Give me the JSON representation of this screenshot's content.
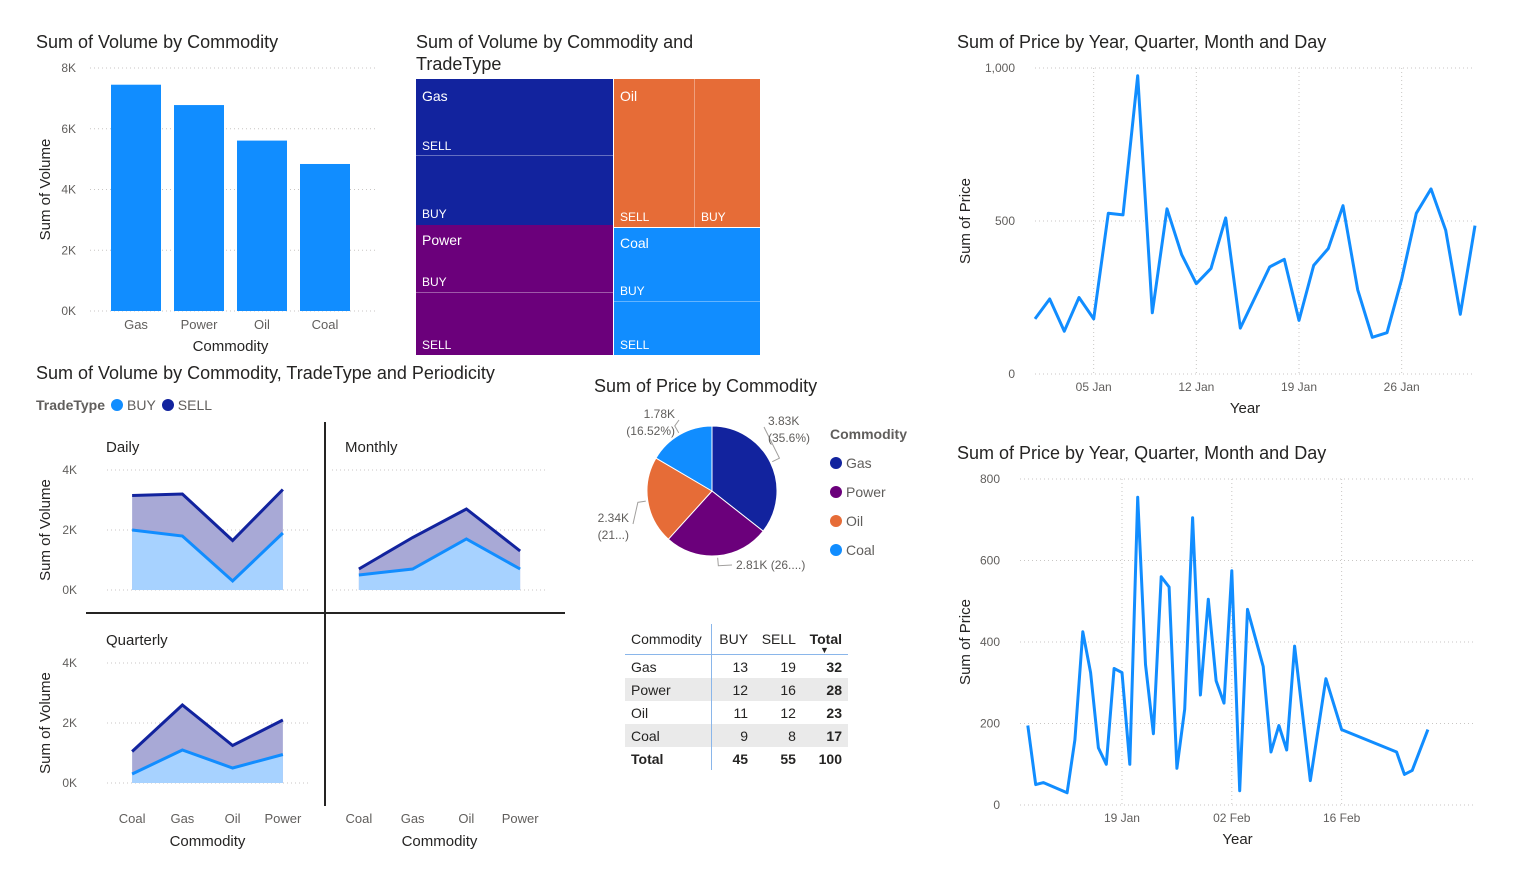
{
  "colors": {
    "bar": "#118DFF",
    "navy": "#12239E",
    "purple": "#6B007B",
    "orange": "#E66C37",
    "blue": "#118DFF",
    "buy_fill": "#A7D2FF",
    "sell_fill": "#A8A9D6",
    "axis_text": "#605e5c",
    "grid": "#c8c6c4"
  },
  "bar_chart": {
    "title": "Sum of Volume by Commodity",
    "chart_data": {
      "type": "bar",
      "categories": [
        "Gas",
        "Power",
        "Oil",
        "Coal"
      ],
      "values": [
        7450,
        6780,
        5610,
        4840
      ],
      "xlabel": "Commodity",
      "ylabel": "Sum of Volume",
      "ylim": [
        0,
        8000
      ],
      "yticks": [
        "0K",
        "2K",
        "4K",
        "6K",
        "8K"
      ],
      "grid": true
    }
  },
  "treemap": {
    "title_line1": "Sum of Volume by Commodity and",
    "title_line2": "TradeType",
    "chart_data": {
      "type": "treemap",
      "groups": [
        {
          "name": "Gas",
          "children": [
            "SELL",
            "BUY"
          ]
        },
        {
          "name": "Oil",
          "children": [
            "SELL",
            "BUY"
          ]
        },
        {
          "name": "Power",
          "children": [
            "BUY",
            "SELL"
          ]
        },
        {
          "name": "Coal",
          "children": [
            "BUY",
            "SELL"
          ]
        }
      ]
    }
  },
  "line_chart_1": {
    "title": "Sum of Price by Year, Quarter, Month and Day",
    "chart_data": {
      "type": "line",
      "xlabel": "Year",
      "ylabel": "Sum of Price",
      "x_ticks": [
        "05 Jan",
        "12 Jan",
        "19 Jan",
        "26 Jan"
      ],
      "y_ticks": [
        "0",
        "500",
        "1,000"
      ],
      "ylim": [
        0,
        1000
      ],
      "x_range": [
        "2024-01-01",
        "2024-01-31"
      ],
      "points": [
        [
          "2024-01-01",
          180
        ],
        [
          "2024-01-02",
          245
        ],
        [
          "2024-01-03",
          140
        ],
        [
          "2024-01-04",
          250
        ],
        [
          "2024-01-05",
          180
        ],
        [
          "2024-01-06",
          525
        ],
        [
          "2024-01-07",
          520
        ],
        [
          "2024-01-08",
          975
        ],
        [
          "2024-01-09",
          200
        ],
        [
          "2024-01-10",
          540
        ],
        [
          "2024-01-11",
          390
        ],
        [
          "2024-01-12",
          295
        ],
        [
          "2024-01-13",
          345
        ],
        [
          "2024-01-14",
          510
        ],
        [
          "2024-01-15",
          150
        ],
        [
          "2024-01-17",
          350
        ],
        [
          "2024-01-18",
          375
        ],
        [
          "2024-01-19",
          175
        ],
        [
          "2024-01-20",
          355
        ],
        [
          "2024-01-21",
          410
        ],
        [
          "2024-01-22",
          550
        ],
        [
          "2024-01-23",
          275
        ],
        [
          "2024-01-24",
          120
        ],
        [
          "2024-01-25",
          135
        ],
        [
          "2024-01-26",
          310
        ],
        [
          "2024-01-27",
          525
        ],
        [
          "2024-01-28",
          605
        ],
        [
          "2024-01-29",
          470
        ],
        [
          "2024-01-30",
          195
        ],
        [
          "2024-01-31",
          485
        ]
      ]
    }
  },
  "line_chart_2": {
    "title": "Sum of Price by Year, Quarter, Month and Day",
    "chart_data": {
      "type": "line",
      "xlabel": "Year",
      "ylabel": "Sum of Price",
      "x_ticks": [
        "19 Jan",
        "02 Feb",
        "16 Feb"
      ],
      "y_ticks": [
        "0",
        "200",
        "400",
        "600",
        "800"
      ],
      "ylim": [
        0,
        800
      ],
      "x_range": [
        "2024-01-06",
        "2024-03-04"
      ],
      "points": [
        [
          "2024-01-07",
          195
        ],
        [
          "2024-01-08",
          50
        ],
        [
          "2024-01-09",
          55
        ],
        [
          "2024-01-12",
          30
        ],
        [
          "2024-01-13",
          160
        ],
        [
          "2024-01-14",
          425
        ],
        [
          "2024-01-15",
          325
        ],
        [
          "2024-01-16",
          140
        ],
        [
          "2024-01-17",
          100
        ],
        [
          "2024-01-18",
          335
        ],
        [
          "2024-01-19",
          325
        ],
        [
          "2024-01-20",
          100
        ],
        [
          "2024-01-21",
          755
        ],
        [
          "2024-01-22",
          345
        ],
        [
          "2024-01-23",
          175
        ],
        [
          "2024-01-24",
          560
        ],
        [
          "2024-01-25",
          535
        ],
        [
          "2024-01-26",
          90
        ],
        [
          "2024-01-27",
          235
        ],
        [
          "2024-01-28",
          705
        ],
        [
          "2024-01-29",
          270
        ],
        [
          "2024-01-30",
          505
        ],
        [
          "2024-01-31",
          305
        ],
        [
          "2024-02-01",
          250
        ],
        [
          "2024-02-02",
          575
        ],
        [
          "2024-02-03",
          35
        ],
        [
          "2024-02-04",
          480
        ],
        [
          "2024-02-06",
          340
        ],
        [
          "2024-02-07",
          130
        ],
        [
          "2024-02-08",
          195
        ],
        [
          "2024-02-09",
          135
        ],
        [
          "2024-02-10",
          390
        ],
        [
          "2024-02-12",
          60
        ],
        [
          "2024-02-14",
          310
        ],
        [
          "2024-02-16",
          185
        ],
        [
          "2024-02-23",
          130
        ],
        [
          "2024-02-24",
          75
        ],
        [
          "2024-02-25",
          85
        ],
        [
          "2024-02-27",
          185
        ]
      ]
    }
  },
  "area_chart": {
    "title": "Sum of Volume by Commodity, TradeType and Periodicity",
    "legend_title": "TradeType",
    "legend_buy": "BUY",
    "legend_sell": "SELL",
    "ylabel": "Sum of Volume",
    "xlabel": "Commodity",
    "yticks": [
      "0K",
      "2K",
      "4K"
    ],
    "chart_data": {
      "type": "area",
      "panels": [
        {
          "name": "Daily",
          "categories": [
            "Coal",
            "Gas",
            "Oil",
            "Power"
          ],
          "series": [
            {
              "name": "BUY",
              "values": [
                2000,
                1800,
                300,
                1900
              ]
            },
            {
              "name": "SELL",
              "values": [
                3150,
                3200,
                1650,
                3350
              ]
            }
          ]
        },
        {
          "name": "Monthly",
          "categories": [
            "Coal",
            "Gas",
            "Oil",
            "Power"
          ],
          "series": [
            {
              "name": "BUY",
              "values": [
                500,
                700,
                1700,
                700
              ]
            },
            {
              "name": "SELL",
              "values": [
                700,
                1750,
                2700,
                1300
              ]
            }
          ]
        },
        {
          "name": "Quarterly",
          "categories": [
            "Coal",
            "Gas",
            "Oil",
            "Power"
          ],
          "series": [
            {
              "name": "BUY",
              "values": [
                300,
                1100,
                500,
                950
              ]
            },
            {
              "name": "SELL",
              "values": [
                1050,
                2600,
                1250,
                2100
              ]
            }
          ]
        }
      ],
      "ylim": [
        0,
        4000
      ]
    }
  },
  "pie_chart": {
    "title": "Sum of Price by Commodity",
    "legend_title": "Commodity",
    "chart_data": {
      "type": "pie",
      "slices": [
        {
          "name": "Gas",
          "value": 3830,
          "label1": "3.83K",
          "label2": "(35.6%)"
        },
        {
          "name": "Power",
          "value": 2810,
          "label1": "2.81K (26....)",
          "label2": ""
        },
        {
          "name": "Oil",
          "value": 2340,
          "label1": "2.34K",
          "label2": "(21...)"
        },
        {
          "name": "Coal",
          "value": 1780,
          "label1": "1.78K",
          "label2": "(16.52%)"
        }
      ]
    }
  },
  "matrix": {
    "headers": [
      "Commodity",
      "BUY",
      "SELL",
      "Total"
    ],
    "rows": [
      [
        "Gas",
        "13",
        "19",
        "32"
      ],
      [
        "Power",
        "12",
        "16",
        "28"
      ],
      [
        "Oil",
        "11",
        "12",
        "23"
      ],
      [
        "Coal",
        "9",
        "8",
        "17"
      ]
    ],
    "total_row": [
      "Total",
      "45",
      "55",
      "100"
    ]
  }
}
